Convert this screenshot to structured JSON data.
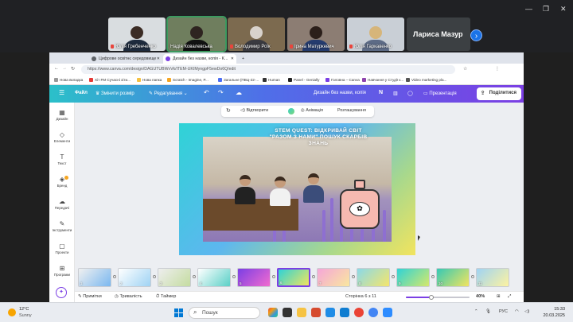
{
  "meeting": {
    "participants": [
      {
        "name": "Юлія Гребенченко"
      },
      {
        "name": "Надія Ковалевська"
      },
      {
        "name": "Володимир Роїк"
      },
      {
        "name": "Ірина Матуркевич"
      },
      {
        "name": "Юлія Гаркавенко"
      }
    ],
    "featured_name": "Лариса Мазур",
    "next_label": "›"
  },
  "browser": {
    "tabs": [
      {
        "title": "Цифрове освітнє середовище"
      },
      {
        "title": "Дизайн без назви, копія - K..."
      }
    ],
    "url": "https://www.canva.com/design/DAGUTUBWvVk/ITEM-UKIMyngpF5ewDo6Q/edit",
    "bookmarks": [
      "Нова вкладка",
      "Хіт FM Сучасні хіти...",
      "Нова папка",
      "Scratch - Imagine, P...",
      "Загальне (ПВЦ-22-...",
      "Human",
      "Panel - Genially",
      "Головна – Canva",
      "Навчання у Студії к...",
      "Video marketing pla..."
    ]
  },
  "canva": {
    "header": {
      "home": "☰",
      "file": "Файл",
      "resize": "Змінити розмір",
      "editing": "Редагування",
      "undo": "↶",
      "redo": "↷",
      "cloud": "☁",
      "doc_title": "Дизайн без назви, копія",
      "avatar": "N",
      "present": "Презентація",
      "share": "Поділитися"
    },
    "sidebar": [
      {
        "icon": "▦",
        "label": "Дизайн"
      },
      {
        "icon": "◇",
        "label": "Елементи"
      },
      {
        "icon": "T",
        "label": "Текст"
      },
      {
        "icon": "◈",
        "label": "Бренд"
      },
      {
        "icon": "☁",
        "label": "Передачі"
      },
      {
        "icon": "✎",
        "label": "Інструменти"
      },
      {
        "icon": "▢",
        "label": "Проекти"
      },
      {
        "icon": "⊞",
        "label": "Програми"
      }
    ],
    "toolbar": {
      "flip": "Відтворити",
      "animation": "Анімація",
      "position": "Розташування"
    },
    "slide": {
      "title": "STEM QUEST: ВІДКРИВАЙ СВІТ \"РАЗОМ З НАМИ\" ПОШУК СКАРБІВ ЗНАНЬ",
      "bottle_glyph": "✿"
    },
    "thumbnails": [
      {
        "num": "1"
      },
      {
        "num": "2"
      },
      {
        "num": "3"
      },
      {
        "num": "4"
      },
      {
        "num": "5"
      },
      {
        "num": "6"
      },
      {
        "num": "7"
      },
      {
        "num": "8"
      },
      {
        "num": "9"
      },
      {
        "num": "10"
      },
      {
        "num": "11"
      }
    ],
    "footer": {
      "notes": "Примітки",
      "duration": "Тривалість",
      "timer": "Таймер",
      "page": "Сторінка 6 з 11",
      "zoom": "40%",
      "zoom_value": 40
    }
  },
  "taskbar": {
    "weather_temp": "12°C",
    "weather_desc": "Sunny",
    "search": "Пошук",
    "lang": "РУС",
    "time": "15:33",
    "date": "20.03.2025"
  },
  "colors": {
    "canva_gradient_start": "#2bc0c9",
    "canva_gradient_end": "#7b3fe4",
    "accent": "#7b3fe4"
  }
}
